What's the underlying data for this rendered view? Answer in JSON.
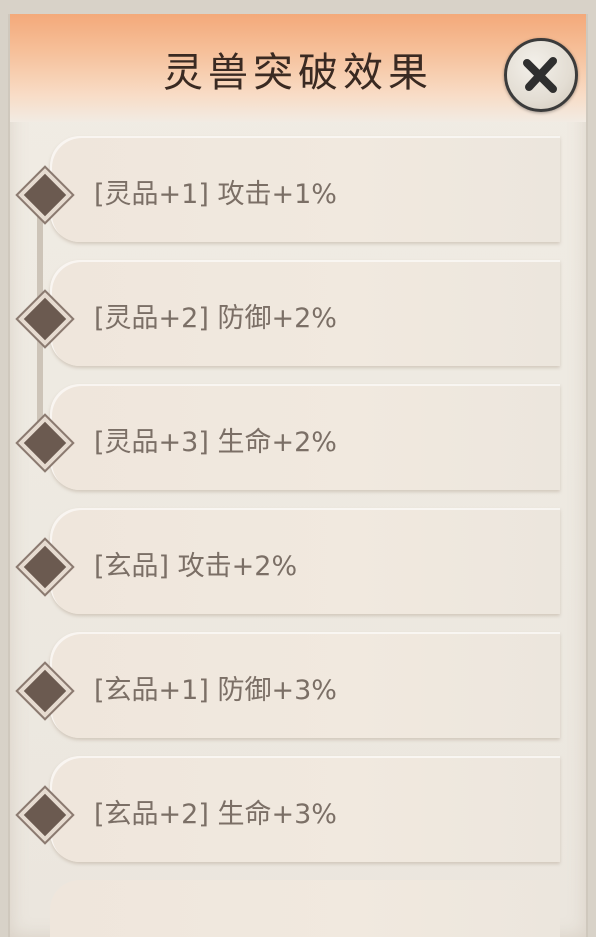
{
  "header": {
    "title": "灵兽突破效果",
    "close_icon": "close-x-icon"
  },
  "effects": [
    {
      "label": "[灵品+1] 攻击+1%"
    },
    {
      "label": "[灵品+2] 防御+2%"
    },
    {
      "label": "[灵品+3] 生命+2%"
    },
    {
      "label": "[玄品] 攻击+2%"
    },
    {
      "label": "[玄品+1] 防御+3%"
    },
    {
      "label": "[玄品+2] 生命+3%"
    }
  ],
  "colors": {
    "header_top": "#f3a97a",
    "text": "#7b6f66",
    "diamond": "#6b5a50"
  }
}
